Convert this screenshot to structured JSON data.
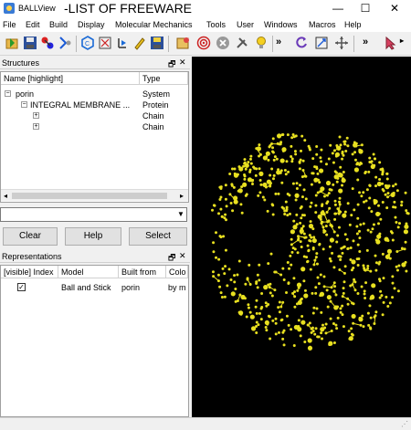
{
  "window": {
    "title": "BALLView",
    "caption": "-LIST OF FREEWARE",
    "controls": {
      "minimize": "—",
      "maximize": "☐",
      "close": "✕"
    }
  },
  "menu": [
    "File",
    "Edit",
    "Build",
    "Display",
    "Molecular Mechanics",
    "Tools",
    "User",
    "Windows",
    "Macros",
    "Help"
  ],
  "toolbar": {
    "overflow_1": "»",
    "overflow_2": "»"
  },
  "structures": {
    "title": "Structures",
    "columns": [
      "Name [highlight]",
      "Type"
    ],
    "rows": [
      {
        "name": "porin",
        "type": "System",
        "expander": "−"
      },
      {
        "name": "INTEGRAL MEMBRANE ...",
        "type": "Protein",
        "expander": "−"
      },
      {
        "name": "",
        "type": "Chain",
        "expander": "+"
      },
      {
        "name": "",
        "type": "Chain",
        "expander": "+"
      }
    ]
  },
  "buttons": {
    "clear": "Clear",
    "help": "Help",
    "select": "Select"
  },
  "representations": {
    "title": "Representations",
    "columns": [
      "[visible] Index",
      "Model",
      "Built from",
      "Colo"
    ],
    "rows": [
      {
        "visible": true,
        "model": "Ball and Stick",
        "built_from": "porin",
        "color": "by m"
      }
    ]
  },
  "panel_icons": {
    "float": "🗗",
    "close": "✕"
  },
  "viewer": {
    "background": "#000000",
    "molecule_color": "#e8e020"
  }
}
